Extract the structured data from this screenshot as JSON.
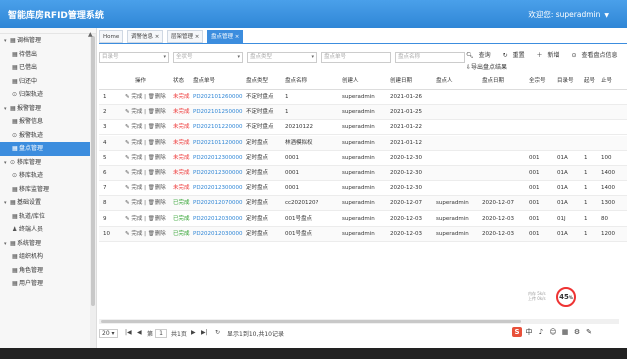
{
  "header": {
    "title": "智能库房RFID管理系统",
    "welcome": "欢迎您: superadmin"
  },
  "sidebar": {
    "items": [
      {
        "label": "调档管理",
        "level": "group",
        "icon": "grid-icon"
      },
      {
        "label": "待借出",
        "level": "child",
        "icon": "grid-icon"
      },
      {
        "label": "已借出",
        "level": "child",
        "icon": "grid-icon"
      },
      {
        "label": "归还中",
        "level": "child",
        "icon": "grid-icon"
      },
      {
        "label": "归架轨迹",
        "level": "child",
        "icon": "location-icon"
      },
      {
        "label": "报警管理",
        "level": "group",
        "icon": "grid-icon"
      },
      {
        "label": "报警信息",
        "level": "child",
        "icon": "grid-icon"
      },
      {
        "label": "报警轨迹",
        "level": "child",
        "icon": "location-icon"
      },
      {
        "label": "盘点管理",
        "level": "child",
        "icon": "grid-icon",
        "active": true
      },
      {
        "label": "移库管理",
        "level": "group",
        "icon": "location-icon"
      },
      {
        "label": "移库轨迹",
        "level": "child",
        "icon": "location-icon"
      },
      {
        "label": "移库监管理",
        "level": "child",
        "icon": "grid-icon"
      },
      {
        "label": "基础设置",
        "level": "group",
        "icon": "grid-icon"
      },
      {
        "label": "轨道/库位",
        "level": "child",
        "icon": "grid-icon"
      },
      {
        "label": "终端人员",
        "level": "child",
        "icon": "user-icon"
      },
      {
        "label": "系统管理",
        "level": "group",
        "icon": "grid-icon"
      },
      {
        "label": "组织机构",
        "level": "child",
        "icon": "grid-icon"
      },
      {
        "label": "角色管理",
        "level": "child",
        "icon": "grid-icon"
      },
      {
        "label": "用户管理",
        "level": "child",
        "icon": "grid-icon"
      }
    ]
  },
  "tabs": [
    {
      "label": "Home",
      "closable": false
    },
    {
      "label": "调警信息",
      "closable": true
    },
    {
      "label": "层架管理",
      "closable": true
    },
    {
      "label": "盘点管理",
      "closable": true,
      "active": true
    }
  ],
  "filters": [
    {
      "placeholder": "目录号",
      "dropdown": true
    },
    {
      "placeholder": "全状号",
      "dropdown": true
    },
    {
      "placeholder": "盘点类型",
      "dropdown": true
    },
    {
      "placeholder": "盘点单号",
      "dropdown": false
    },
    {
      "placeholder": "盘点名称",
      "dropdown": false
    }
  ],
  "actions": {
    "query": "查询",
    "reset": "重置",
    "add": "新增",
    "view": "查看盘点信息",
    "export": "导出盘点结果"
  },
  "table": {
    "columns": [
      "",
      "操作",
      "状态",
      "盘点单号",
      "盘点类型",
      "盘点名称",
      "创建人",
      "创建日期",
      "盘点人",
      "盘点日期",
      "全宗号",
      "目录号",
      "起号",
      "止号"
    ],
    "rows": [
      {
        "n": "1",
        "op1": "完成",
        "op2": "删除",
        "status": "未完成",
        "code": "PD202101260000",
        "type": "不定时盘点",
        "name": "1",
        "creator": "superadmin",
        "created": "2021-01-26",
        "checker": "",
        "checked": "",
        "qz": "",
        "ml": "",
        "from": "",
        "to": ""
      },
      {
        "n": "2",
        "op1": "完成",
        "op2": "删除",
        "status": "未完成",
        "code": "PD202101250000",
        "type": "不定时盘点",
        "name": "1",
        "creator": "superadmin",
        "created": "2021-01-25",
        "checker": "",
        "checked": "",
        "qz": "",
        "ml": "",
        "from": "",
        "to": ""
      },
      {
        "n": "3",
        "op1": "完成",
        "op2": "删除",
        "status": "未完成",
        "code": "PD202101220000",
        "type": "不定时盘点",
        "name": "20210122",
        "creator": "superadmin",
        "created": "2021-01-22",
        "checker": "",
        "checked": "",
        "qz": "",
        "ml": "",
        "from": "",
        "to": ""
      },
      {
        "n": "4",
        "op1": "完成",
        "op2": "删除",
        "status": "未完成",
        "code": "PD202101120000",
        "type": "定时盘点",
        "name": "林酒模拟权",
        "creator": "superadmin",
        "created": "2021-01-12",
        "checker": "",
        "checked": "",
        "qz": "",
        "ml": "",
        "from": "",
        "to": ""
      },
      {
        "n": "5",
        "op1": "完成",
        "op2": "删除",
        "status": "未完成",
        "code": "PD202012300000",
        "type": "定时盘点",
        "name": "0001",
        "creator": "superadmin",
        "created": "2020-12-30",
        "checker": "",
        "checked": "",
        "qz": "001",
        "ml": "01A",
        "from": "1",
        "to": "100"
      },
      {
        "n": "6",
        "op1": "完成",
        "op2": "删除",
        "status": "未完成",
        "code": "PD202012300000",
        "type": "定时盘点",
        "name": "0001",
        "creator": "superadmin",
        "created": "2020-12-30",
        "checker": "",
        "checked": "",
        "qz": "001",
        "ml": "01A",
        "from": "1",
        "to": "1400"
      },
      {
        "n": "7",
        "op1": "完成",
        "op2": "删除",
        "status": "未完成",
        "code": "PD202012300000",
        "type": "定时盘点",
        "name": "0001",
        "creator": "superadmin",
        "created": "2020-12-30",
        "checker": "",
        "checked": "",
        "qz": "001",
        "ml": "01A",
        "from": "1",
        "to": "1400"
      },
      {
        "n": "8",
        "op1": "完成",
        "op2": "删除",
        "status": "已完成",
        "code": "PD202012070000",
        "type": "定时盘点",
        "name": "cc2020120?",
        "creator": "superadmin",
        "created": "2020-12-07",
        "checker": "superadmin",
        "checked": "2020-12-07",
        "qz": "001",
        "ml": "01A",
        "from": "1",
        "to": "1300"
      },
      {
        "n": "9",
        "op1": "完成",
        "op2": "删除",
        "status": "已完成",
        "code": "PD202012030000",
        "type": "定时盘点",
        "name": "001号盘点",
        "creator": "superadmin",
        "created": "2020-12-03",
        "checker": "superadmin",
        "checked": "2020-12-03",
        "qz": "001",
        "ml": "01J",
        "from": "1",
        "to": "80"
      },
      {
        "n": "10",
        "op1": "完成",
        "op2": "删除",
        "status": "已完成",
        "code": "PD202012030000",
        "type": "定时盘点",
        "name": "001号盘点",
        "creator": "superadmin",
        "created": "2020-12-03",
        "checker": "superadmin",
        "checked": "2020-12-03",
        "qz": "001",
        "ml": "01A",
        "from": "1",
        "to": "1200"
      }
    ]
  },
  "pager": {
    "page_size": "20",
    "page_label": "第",
    "page": "1",
    "total_pages": "共1页",
    "summary": "显示1到10,共10记录"
  },
  "widget": {
    "percent": "45",
    "unit": "%",
    "line1": "内存 5k/s",
    "line2": "上传 0k/s"
  },
  "colors": {
    "accent": "#3c8dde",
    "unfinished": "#ee3333",
    "finished": "#2aa02a"
  }
}
